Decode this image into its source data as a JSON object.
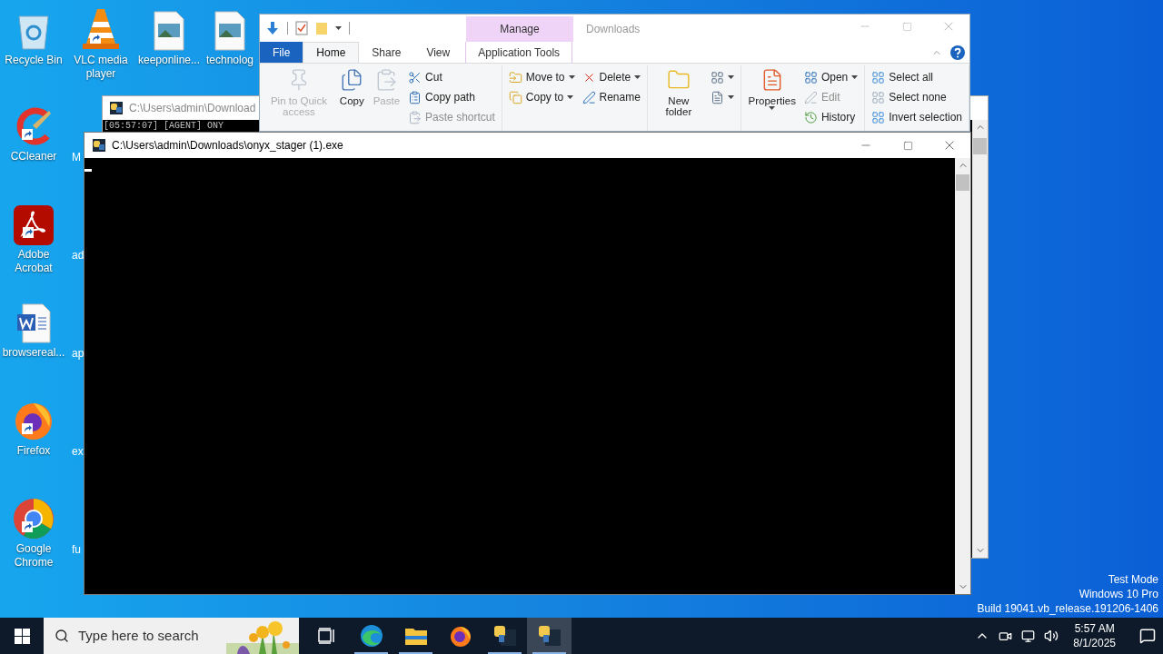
{
  "desktop": {
    "icons": [
      {
        "kind": "recycle-bin",
        "label": "Recycle Bin",
        "shortcut": false
      },
      {
        "kind": "vlc",
        "label": "VLC media player",
        "shortcut": true
      },
      {
        "kind": "image-file",
        "label": "keeponline...",
        "shortcut": false
      },
      {
        "kind": "image-file",
        "label": "technolog",
        "shortcut": false
      },
      {
        "kind": "ccleaner",
        "label": "CCleaner",
        "shortcut": true
      },
      {
        "kind": "hidden",
        "label": "M"
      },
      {
        "kind": "acrobat",
        "label": "Adobe Acrobat",
        "shortcut": true
      },
      {
        "kind": "hidden",
        "label": "ad"
      },
      {
        "kind": "word-file",
        "label": "browsereal...",
        "shortcut": false
      },
      {
        "kind": "hidden",
        "label": "ap"
      },
      {
        "kind": "firefox",
        "label": "Firefox",
        "shortcut": true
      },
      {
        "kind": "hidden",
        "label": "ex"
      },
      {
        "kind": "chrome",
        "label": "Google Chrome",
        "shortcut": true
      },
      {
        "kind": "hidden",
        "label": "fu"
      }
    ],
    "system_text": [
      "Test Mode",
      "Windows 10 Pro",
      "Build 19041.vb_release.191206-1406"
    ]
  },
  "back_console": {
    "title": "C:\\Users\\admin\\Download",
    "line": "[05:57:07] [AGENT] ONY"
  },
  "explorer": {
    "title": "Downloads",
    "context_label": "Manage",
    "tabs": [
      {
        "label": "File",
        "kind": "file",
        "selected": false
      },
      {
        "label": "Home",
        "kind": "plain",
        "selected": true
      },
      {
        "label": "Share",
        "kind": "plain",
        "selected": false
      },
      {
        "label": "View",
        "kind": "plain",
        "selected": false
      },
      {
        "label": "Application Tools",
        "kind": "context",
        "selected": false
      }
    ],
    "groups": [
      {
        "columns": [
          {
            "kind": "large",
            "items": [
              {
                "label": "Pin to Quick access",
                "disabled": true,
                "dropdown": false
              }
            ]
          },
          {
            "kind": "large",
            "items": [
              {
                "label": "Copy",
                "disabled": false,
                "dropdown": false
              }
            ]
          },
          {
            "kind": "large",
            "items": [
              {
                "label": "Paste",
                "disabled": true,
                "dropdown": false
              }
            ]
          },
          {
            "kind": "stack",
            "items": [
              {
                "label": "Cut",
                "disabled": false,
                "dropdown": false
              },
              {
                "label": "Copy path",
                "disabled": false,
                "dropdown": false
              },
              {
                "label": "Paste shortcut",
                "disabled": true,
                "dropdown": false
              }
            ]
          }
        ]
      },
      {
        "columns": [
          {
            "kind": "stack",
            "items": [
              {
                "label": "Move to",
                "disabled": false,
                "dropdown": true
              },
              {
                "label": "Copy to",
                "disabled": false,
                "dropdown": true
              }
            ]
          },
          {
            "kind": "stack",
            "items": [
              {
                "label": "Delete",
                "disabled": false,
                "dropdown": true
              },
              {
                "label": "Rename",
                "disabled": false,
                "dropdown": false
              }
            ]
          }
        ]
      },
      {
        "columns": [
          {
            "kind": "large",
            "items": [
              {
                "label": "New folder",
                "disabled": false,
                "dropdown": false
              }
            ]
          },
          {
            "kind": "stack",
            "items": [
              {
                "disabled": false,
                "dropdown": true
              },
              {
                "disabled": false,
                "dropdown": true
              }
            ]
          }
        ]
      },
      {
        "columns": [
          {
            "kind": "large",
            "items": [
              {
                "label": "Properties",
                "disabled": false,
                "dropdown": true
              }
            ]
          },
          {
            "kind": "stack",
            "items": [
              {
                "label": "Open",
                "disabled": false,
                "dropdown": true
              },
              {
                "label": "Edit",
                "disabled": true,
                "dropdown": false
              },
              {
                "label": "History",
                "disabled": false,
                "dropdown": false
              }
            ]
          }
        ]
      },
      {
        "columns": [
          {
            "kind": "stack",
            "items": [
              {
                "label": "Select all",
                "disabled": false,
                "dropdown": false
              },
              {
                "label": "Select none",
                "disabled": false,
                "dropdown": false
              },
              {
                "label": "Invert selection",
                "disabled": false,
                "dropdown": false
              }
            ]
          }
        ]
      }
    ]
  },
  "console": {
    "title": "C:\\Users\\admin\\Downloads\\onyx_stager (1).exe",
    "cursor": true
  },
  "taskbar": {
    "search_placeholder": "Type here to search",
    "apps": [
      {
        "kind": "task-view",
        "running": false,
        "selected": false
      },
      {
        "kind": "edge",
        "running": true,
        "selected": false
      },
      {
        "kind": "explorer",
        "running": true,
        "selected": false
      },
      {
        "kind": "firefox",
        "running": false,
        "selected": false
      },
      {
        "kind": "console",
        "running": true,
        "selected": false
      },
      {
        "kind": "console",
        "running": true,
        "selected": true
      }
    ],
    "time": "5:57 AM",
    "date": "8/1/2025"
  }
}
